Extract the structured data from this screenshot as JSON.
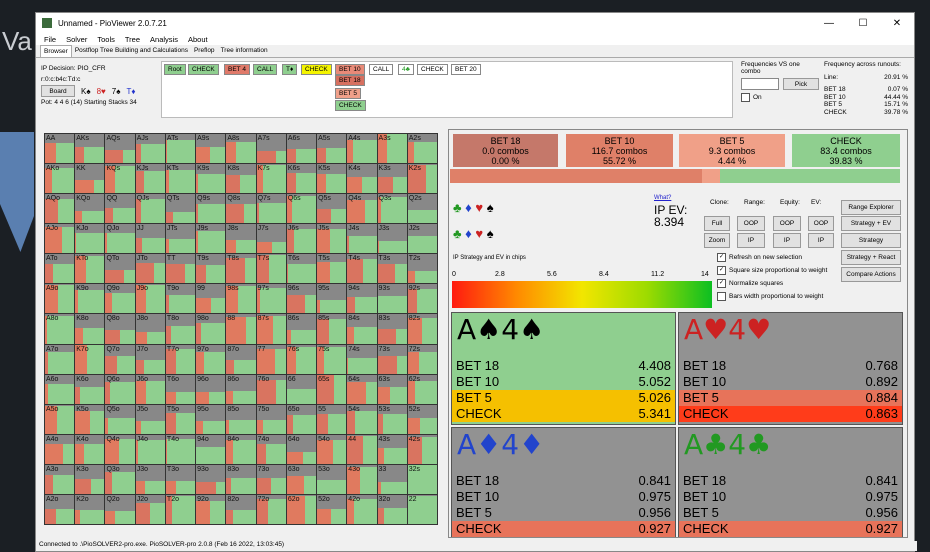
{
  "window": {
    "title": "Unnamed - PioViewer 2.0.7.21",
    "min": "—",
    "max": "☐",
    "close": "✕"
  },
  "background": {
    "left_text": "Va"
  },
  "menu": [
    "File",
    "Solver",
    "Tools",
    "Tree",
    "Analysis",
    "About"
  ],
  "tabs": [
    "Browser",
    "Postflop Tree Building and Calculations",
    "Preflop",
    "Tree information"
  ],
  "info": {
    "decision": "IP Decision:  PIO_CFR",
    "board_code": "r:0:c:b4c:Td:c",
    "board_button": "Board",
    "board_cards": [
      "K♠",
      "8♥",
      "7♠",
      "T♦"
    ],
    "pot": "Pot: 4 4 6 (14) Starting Stacks 34"
  },
  "tree": [
    {
      "label": "Root",
      "bg": "#8fcf8f"
    },
    {
      "label": "CHECK",
      "bg": "#8fcf8f"
    },
    {
      "label": "BET 4",
      "bg": "#e07a6a"
    },
    {
      "label": "CALL",
      "bg": "#8fcf8f"
    },
    {
      "label": "T♦",
      "bg": "#8fcf8f"
    },
    {
      "label": "CHECK",
      "bg": "#f4f400"
    },
    {
      "label": "BET 10",
      "bg": "#e88a78"
    },
    {
      "label": "BET 18",
      "bg": "#d77060"
    },
    {
      "label": "BET 5",
      "bg": "#f0a08a"
    },
    {
      "label": "CHECK",
      "bg": "#8fcf8f"
    },
    {
      "label": "CALL",
      "bg": "#fff"
    },
    {
      "label": "4♣",
      "bg": "#fff"
    },
    {
      "label": "CHECK",
      "bg": "#fff"
    },
    {
      "label": "BET 20",
      "bg": "#fff"
    }
  ],
  "freq_vs": {
    "title": "Frequencies VS one combo",
    "pick": "Pick",
    "on": "On"
  },
  "freq_runouts": {
    "title": "Frequency across runouts:",
    "rows": [
      [
        "Line:",
        "20.91 %"
      ],
      [
        "BET 18",
        "0.07 %"
      ],
      [
        "BET 10",
        "44.44 %"
      ],
      [
        "BET 5",
        "15.71 %"
      ],
      [
        "CHECK",
        "39.78 %"
      ]
    ]
  },
  "grid_labels": [
    [
      "AA",
      "AKs",
      "AQs",
      "AJs",
      "ATs",
      "A9s",
      "A8s",
      "A7s",
      "A6s",
      "A5s",
      "A4s",
      "A3s",
      "A2s"
    ],
    [
      "AKo",
      "KK",
      "KQs",
      "KJs",
      "KTs",
      "K9s",
      "K8s",
      "K7s",
      "K6s",
      "K5s",
      "K4s",
      "K3s",
      "K2s"
    ],
    [
      "AQo",
      "KQo",
      "QQ",
      "QJs",
      "QTs",
      "Q9s",
      "Q8s",
      "Q7s",
      "Q6s",
      "Q5s",
      "Q4s",
      "Q3s",
      "Q2s"
    ],
    [
      "AJo",
      "KJo",
      "QJo",
      "JJ",
      "JTs",
      "J9s",
      "J8s",
      "J7s",
      "J6s",
      "J5s",
      "J4s",
      "J3s",
      "J2s"
    ],
    [
      "ATo",
      "KTo",
      "QTo",
      "JTo",
      "TT",
      "T9s",
      "T8s",
      "T7s",
      "T6s",
      "T5s",
      "T4s",
      "T3s",
      "T2s"
    ],
    [
      "A9o",
      "K9o",
      "Q9o",
      "J9o",
      "T9o",
      "99",
      "98s",
      "97s",
      "96s",
      "95s",
      "94s",
      "93s",
      "92s"
    ],
    [
      "A8o",
      "K8o",
      "Q8o",
      "J8o",
      "T8o",
      "98o",
      "88",
      "87s",
      "86s",
      "85s",
      "84s",
      "83s",
      "82s"
    ],
    [
      "A7o",
      "K7o",
      "Q7o",
      "J7o",
      "T7o",
      "97o",
      "87o",
      "77",
      "76s",
      "75s",
      "74s",
      "73s",
      "72s"
    ],
    [
      "A6o",
      "K6o",
      "Q6o",
      "J6o",
      "T6o",
      "96o",
      "86o",
      "76o",
      "66",
      "65s",
      "64s",
      "63s",
      "62s"
    ],
    [
      "A5o",
      "K5o",
      "Q5o",
      "J5o",
      "T5o",
      "95o",
      "85o",
      "75o",
      "65o",
      "55",
      "54s",
      "53s",
      "52s"
    ],
    [
      "A4o",
      "K4o",
      "Q4o",
      "J4o",
      "T4o",
      "94o",
      "84o",
      "74o",
      "64o",
      "54o",
      "44",
      "43s",
      "42s"
    ],
    [
      "A3o",
      "K3o",
      "Q3o",
      "J3o",
      "T3o",
      "93o",
      "83o",
      "73o",
      "63o",
      "53o",
      "43o",
      "33",
      "32s"
    ],
    [
      "A2o",
      "K2o",
      "Q2o",
      "J2o",
      "T2o",
      "92o",
      "82o",
      "72o",
      "62o",
      "52o",
      "42o",
      "32o",
      "22"
    ]
  ],
  "actions": [
    {
      "name": "BET 18",
      "combos": "0.0 combos",
      "pct": "0.00 %",
      "bg": "#c5786a"
    },
    {
      "name": "BET 10",
      "combos": "116.7 combos",
      "pct": "55.72 %",
      "bg": "#df8068"
    },
    {
      "name": "BET 5",
      "combos": "9.3 combos",
      "pct": "4.44 %",
      "bg": "#f0a088"
    },
    {
      "name": "CHECK",
      "combos": "83.4 combos",
      "pct": "39.83 %",
      "bg": "#8fcf8f"
    }
  ],
  "suit_rows": {
    "row1": [
      "♣",
      "♦",
      "♥",
      "♠"
    ],
    "row2": [
      "♣",
      "♦",
      "♥",
      "♠"
    ]
  },
  "ev": {
    "what": "What?",
    "label": "IP EV:",
    "value": "8.394"
  },
  "controls": {
    "clone": "Clone:",
    "range": "Range:",
    "equity": "Equity:",
    "ev": "EV:",
    "full": "Full",
    "zoom": "Zoom",
    "oop": "OOP",
    "ip": "IP"
  },
  "right_buttons": [
    "Range Explorer",
    "Strategy + EV",
    "Strategy",
    "Strategy + React",
    "Compare Actions"
  ],
  "checkboxes": [
    {
      "label": "Refresh on new selection",
      "checked": "✓"
    },
    {
      "label": "Square size proportional to weight",
      "checked": "✓"
    },
    {
      "label": "Normalize squares",
      "checked": "✓"
    },
    {
      "label": "Bars width proportional to weight",
      "checked": ""
    }
  ],
  "strategy_label": "IP Strategy and EV in chips",
  "scale": [
    "0",
    "2.8",
    "5.6",
    "8.4",
    "11.2",
    "14"
  ],
  "quads": [
    {
      "rank1": "A",
      "suit1": "♠",
      "rank2": "4",
      "suit2": "♠",
      "color": "#000",
      "bg": "#8fcf8f",
      "rows": [
        [
          "BET 18",
          "4.408",
          "#8fcf8f"
        ],
        [
          "BET 10",
          "5.052",
          "#8fcf8f"
        ],
        [
          "BET 5",
          "5.026",
          "#f5c000"
        ],
        [
          "CHECK",
          "5.341",
          "#f5c000"
        ]
      ]
    },
    {
      "rank1": "A",
      "suit1": "♥",
      "rank2": "4",
      "suit2": "♥",
      "color": "#cc2222",
      "bg": "#929292",
      "rows": [
        [
          "BET 18",
          "0.768",
          "#929292"
        ],
        [
          "BET 10",
          "0.892",
          "#929292"
        ],
        [
          "BET 5",
          "0.884",
          "#e7735a"
        ],
        [
          "CHECK",
          "0.863",
          "#ff3c1a"
        ]
      ]
    },
    {
      "rank1": "A",
      "suit1": "♦",
      "rank2": "4",
      "suit2": "♦",
      "color": "#2244cc",
      "bg": "#929292",
      "rows": [
        [
          "BET 18",
          "0.841",
          "#929292"
        ],
        [
          "BET 10",
          "0.975",
          "#929292"
        ],
        [
          "BET 5",
          "0.956",
          "#929292"
        ],
        [
          "CHECK",
          "0.927",
          "#e7735a"
        ]
      ]
    },
    {
      "rank1": "A",
      "suit1": "♣",
      "rank2": "4",
      "suit2": "♣",
      "color": "#229922",
      "bg": "#929292",
      "rows": [
        [
          "BET 18",
          "0.841",
          "#929292"
        ],
        [
          "BET 10",
          "0.975",
          "#929292"
        ],
        [
          "BET 5",
          "0.956",
          "#929292"
        ],
        [
          "CHECK",
          "0.927",
          "#e7735a"
        ]
      ]
    }
  ],
  "status": "Connected to .\\PioSOLVER2-pro.exe. PioSOLVER-pro 2.0.8 (Feb 16 2022, 13:03:45)"
}
